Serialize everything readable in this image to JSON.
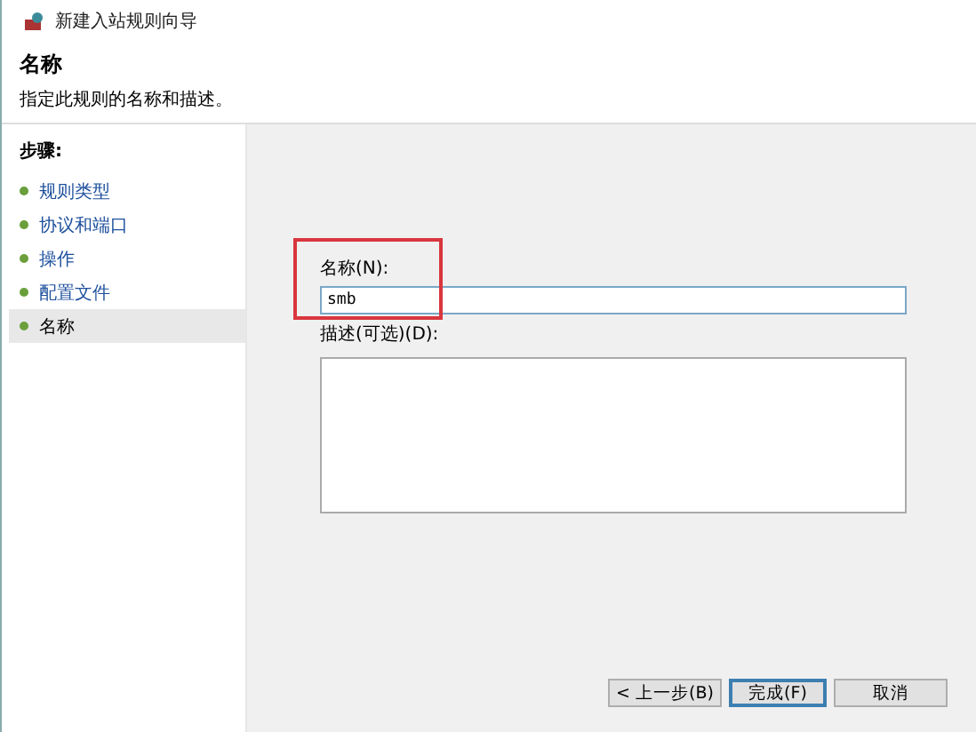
{
  "window": {
    "title": "新建入站规则向导"
  },
  "header": {
    "title": "名称",
    "subtitle": "指定此规则的名称和描述。"
  },
  "steps": {
    "label": "步骤:",
    "items": [
      {
        "label": "规则类型",
        "selected": false
      },
      {
        "label": "协议和端口",
        "selected": false
      },
      {
        "label": "操作",
        "selected": false
      },
      {
        "label": "配置文件",
        "selected": false
      },
      {
        "label": "名称",
        "selected": true
      }
    ]
  },
  "name_field": {
    "label": "名称(N):",
    "value": "smb",
    "highlighted": true
  },
  "description_field": {
    "label": "描述(可选)(D):"
  },
  "buttons": [
    {
      "label": "< 上一步(B)",
      "default": false
    },
    {
      "label": "完成(F)",
      "default": true
    },
    {
      "label": "取消",
      "default": false
    }
  ]
}
